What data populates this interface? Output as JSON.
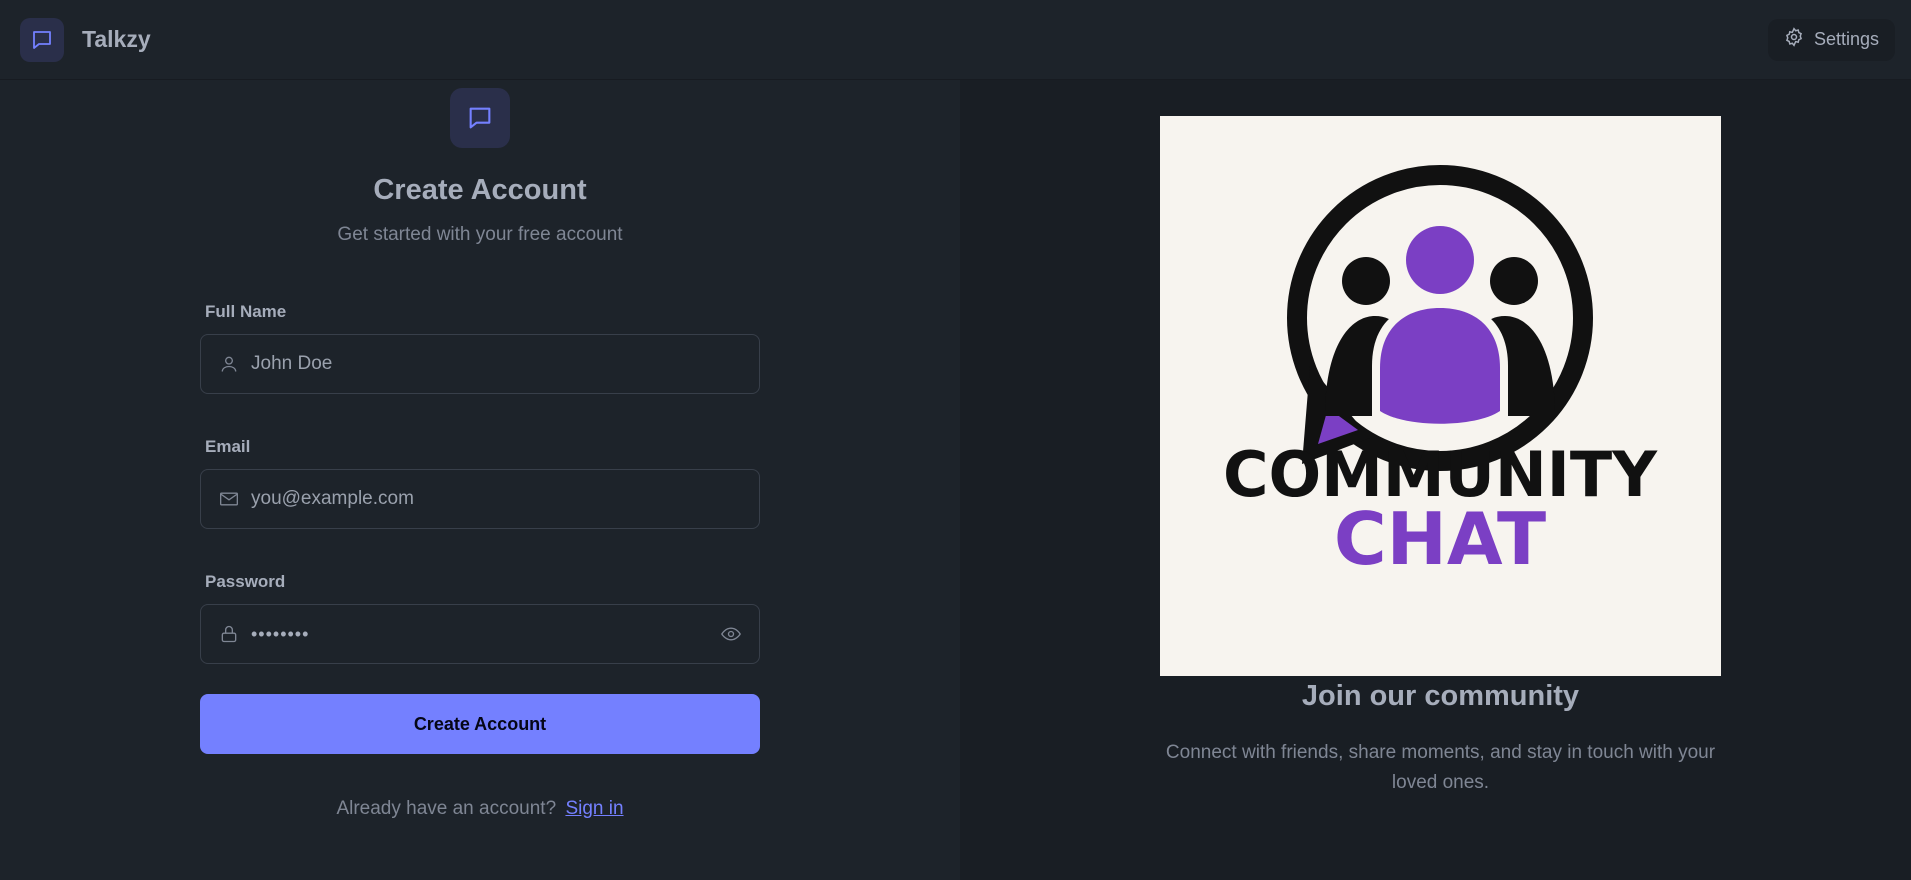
{
  "app": {
    "name": "Talkzy",
    "settings_label": "Settings"
  },
  "form": {
    "title": "Create Account",
    "subtitle": "Get started with your free account",
    "full_name": {
      "label": "Full Name",
      "placeholder": "John Doe",
      "icon": "user-icon"
    },
    "email": {
      "label": "Email",
      "placeholder": "you@example.com",
      "icon": "mail-icon"
    },
    "password": {
      "label": "Password",
      "value": "••••••••",
      "icon": "lock-icon",
      "toggle_icon": "eye-icon"
    },
    "submit_label": "Create Account",
    "signin_prompt": "Already have an account?",
    "signin_link": "Sign in"
  },
  "promo": {
    "logo_text_line1": "COMMUNITY",
    "logo_text_line2": "CHAT",
    "title": "Join our community",
    "text": "Connect with friends, share moments, and stay in touch with your loved ones."
  },
  "colors": {
    "accent": "#7480ff",
    "logo_purple": "#7b3fc4",
    "background": "#1d232a"
  }
}
